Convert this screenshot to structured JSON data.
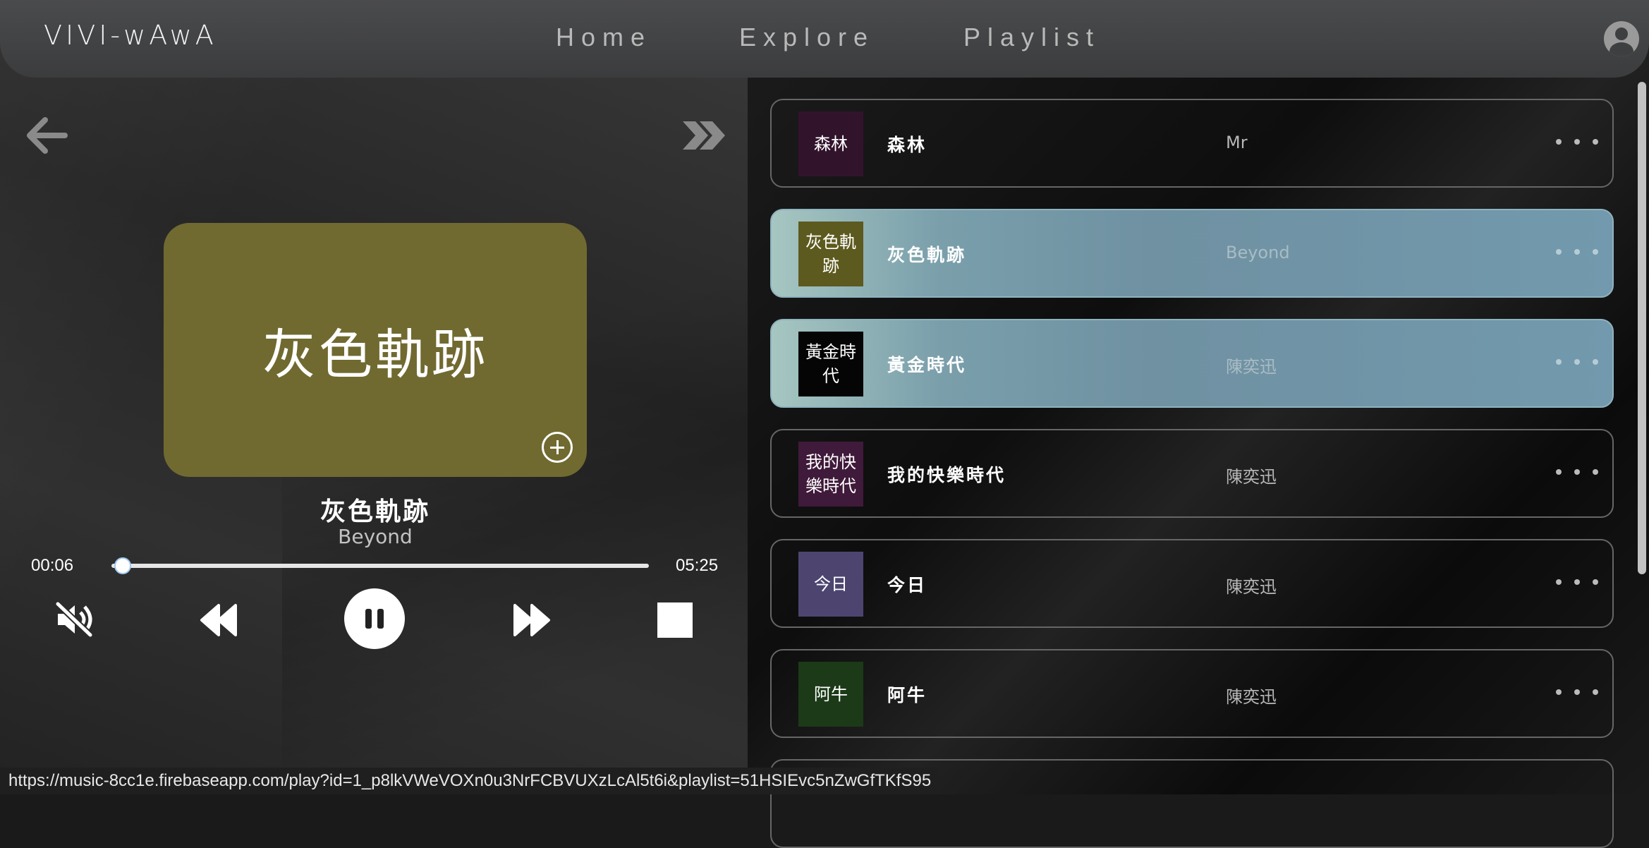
{
  "navbar": {
    "brand": "VIVI-wAwA",
    "links": [
      "Home",
      "Explore",
      "Playlist"
    ]
  },
  "player": {
    "cover_title": "灰色軌跡",
    "title": "灰色軌跡",
    "artist": "Beyond",
    "current_time": "00:06",
    "duration": "05:25",
    "progress_fraction": 0.018,
    "muted": true,
    "playing": true,
    "cover_color": "#706a31"
  },
  "playlist": {
    "rows": [
      {
        "thumb": "森林",
        "title": "森林",
        "artist": "Mr",
        "thumb_color": "#32132c",
        "active": false
      },
      {
        "thumb": "灰色軌跡",
        "title": "灰色軌跡",
        "artist": "Beyond",
        "thumb_color": "#5d5a1f",
        "active": true
      },
      {
        "thumb": "黃金時代",
        "title": "黃金時代",
        "artist": "陳奕迅",
        "thumb_color": "#050505",
        "active": true
      },
      {
        "thumb": "我的快樂時代",
        "title": "我的快樂時代",
        "artist": "陳奕迅",
        "thumb_color": "#401a3a",
        "active": false
      },
      {
        "thumb": "今日",
        "title": "今日",
        "artist": "陳奕迅",
        "thumb_color": "#4d4570",
        "active": false
      },
      {
        "thumb": "阿牛",
        "title": "阿牛",
        "artist": "陳奕迅",
        "thumb_color": "#1c3a18",
        "active": false
      }
    ]
  },
  "status_url": "https://music-8cc1e.firebaseapp.com/play?id=1_p8lkVWeVOXn0u3NrFCBVUXzLcAl5t6i&playlist=51HSIEvc5nZwGfTKfS95",
  "icons": {
    "back": "arrow-left-icon",
    "forward": "double-chevron-right-icon",
    "mute": "volume-mute-icon",
    "rewind": "rewind-icon",
    "pause": "pause-icon",
    "fast_forward": "fast-forward-icon",
    "stop": "stop-icon",
    "add": "add-circle-icon",
    "more": "more-horizontal-icon",
    "user": "user-avatar-icon"
  }
}
